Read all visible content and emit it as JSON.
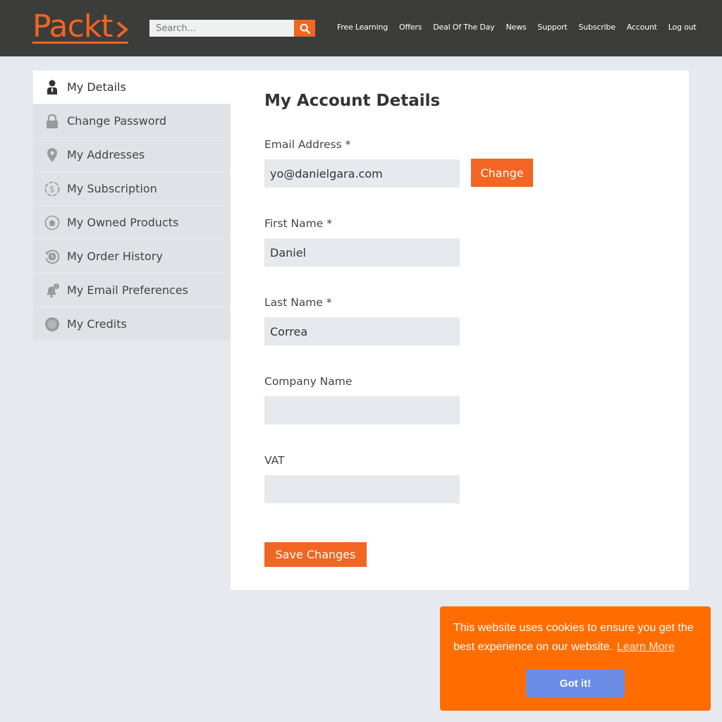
{
  "header": {
    "logo_text": "Packt",
    "search_placeholder": "Search...",
    "nav": [
      "Free Learning",
      "Offers",
      "Deal Of The Day",
      "News",
      "Support",
      "Subscribe",
      "Account",
      "Log out"
    ]
  },
  "sidebar": {
    "items": [
      {
        "label": "My Details",
        "icon": "user-icon",
        "active": true
      },
      {
        "label": "Change Password",
        "icon": "lock-icon"
      },
      {
        "label": "My Addresses",
        "icon": "map-pin-icon"
      },
      {
        "label": "My Subscription",
        "icon": "dollar-icon"
      },
      {
        "label": "My Owned Products",
        "icon": "home-icon"
      },
      {
        "label": "My Order History",
        "icon": "history-icon"
      },
      {
        "label": "My Email Preferences",
        "icon": "bell-icon"
      },
      {
        "label": "My Credits",
        "icon": "credits-icon"
      }
    ]
  },
  "main": {
    "title": "My Account Details",
    "email": {
      "label": "Email Address *",
      "value": "yo@danielgara.com",
      "change_label": "Change"
    },
    "first_name": {
      "label": "First Name *",
      "value": "Daniel"
    },
    "last_name": {
      "label": "Last Name *",
      "value": "Correa"
    },
    "company": {
      "label": "Company Name",
      "value": ""
    },
    "vat": {
      "label": "VAT",
      "value": ""
    },
    "save_label": "Save Changes"
  },
  "cookie": {
    "text": "This website uses cookies to ensure you get the best experience on our website.",
    "learn_more": "Learn More",
    "accept_label": "Got it!"
  },
  "colors": {
    "accent": "#f26522",
    "header_bg": "#3c3c3b",
    "cookie_bg": "#ff6d00",
    "cookie_btn": "#6b8de8"
  }
}
